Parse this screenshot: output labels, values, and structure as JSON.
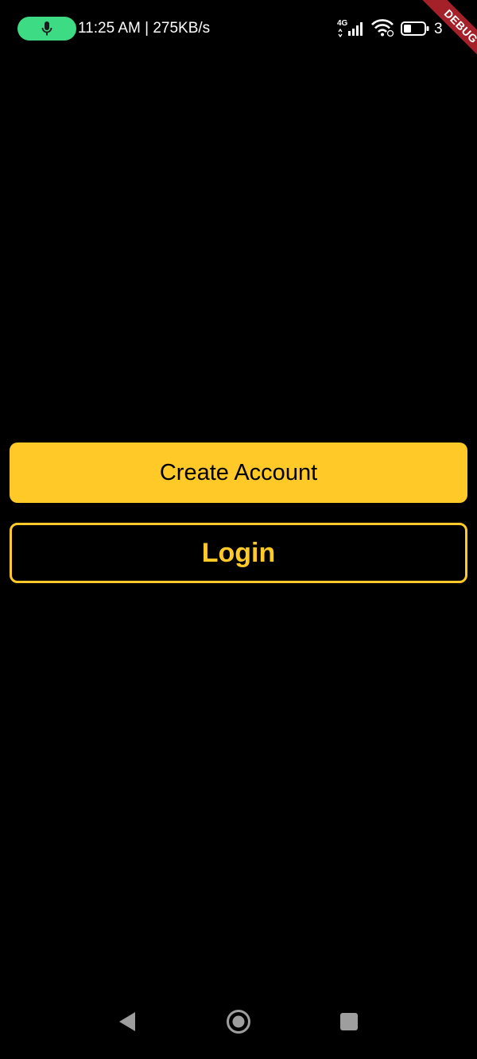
{
  "status_bar": {
    "time_and_speed": "11:25 AM | 275KB/s",
    "network_type": "4G",
    "battery_level": "3",
    "mic_indicator_color": "#3ddc84",
    "icons": [
      "mic-icon",
      "signal-icon",
      "wifi-icon",
      "battery-icon"
    ]
  },
  "debug_banner": {
    "label": "DEBUG",
    "color": "#a4212a"
  },
  "actions": {
    "create_account_label": "Create Account",
    "login_label": "Login"
  },
  "theme": {
    "background": "#000000",
    "accent": "#ffc928"
  },
  "nav_bar": {
    "icons": [
      "back-icon",
      "home-icon",
      "recents-icon"
    ]
  }
}
